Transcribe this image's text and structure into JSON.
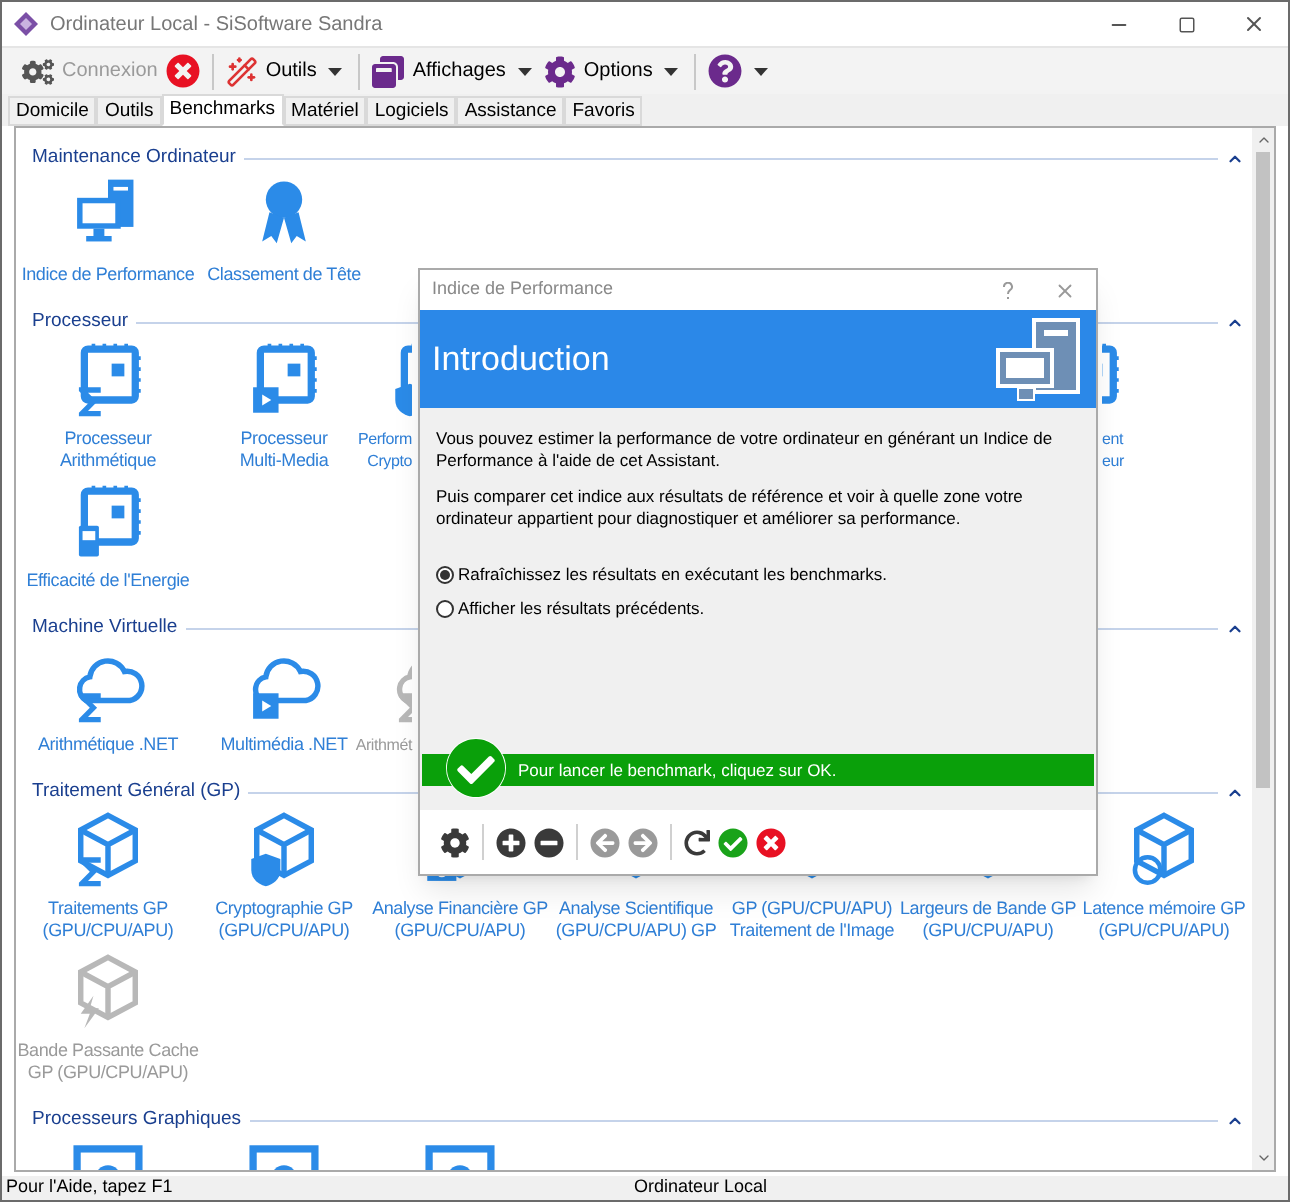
{
  "window": {
    "title": "Ordinateur Local - SiSoftware Sandra"
  },
  "toolbar": [
    {
      "kind": "connect",
      "label": "Connexion",
      "disabled": true
    },
    {
      "kind": "stop"
    },
    {
      "kind": "tools",
      "label": "Outils",
      "dropdown": true
    },
    {
      "kind": "views",
      "label": "Affichages",
      "dropdown": true
    },
    {
      "kind": "options",
      "label": "Options",
      "dropdown": true
    },
    {
      "kind": "help",
      "dropdown": true
    }
  ],
  "tabs": [
    {
      "label": "Domicile",
      "selected": false
    },
    {
      "label": "Outils",
      "selected": false
    },
    {
      "label": "Benchmarks",
      "selected": true
    },
    {
      "label": "Matériel",
      "selected": false
    },
    {
      "label": "Logiciels",
      "selected": false
    },
    {
      "label": "Assistance",
      "selected": false
    },
    {
      "label": "Favoris",
      "selected": false
    }
  ],
  "sections": [
    {
      "title": "Maintenance Ordinateur",
      "expanded": true,
      "items": [
        {
          "label_lines": [
            "Indice de Performance"
          ],
          "disabled": false
        },
        {
          "label_lines": [
            "Classement de Tête"
          ],
          "disabled": false
        }
      ]
    },
    {
      "title": "Processeur",
      "expanded": true,
      "items": [
        {
          "label_lines": [
            "Processeur",
            "Arithmétique"
          ],
          "disabled": false
        },
        {
          "label_lines": [
            "Processeur",
            "Multi-Media"
          ],
          "disabled": false
        },
        {
          "label_lines": [
            "Perform",
            "Crypto"
          ],
          "disabled": false,
          "covered_on_right": true
        },
        {
          "label_lines": [
            "ent",
            "eur"
          ],
          "disabled": false,
          "covered_on_left": true
        },
        {
          "label_lines": [
            "Efficacité de l'Energie"
          ],
          "disabled": false
        }
      ]
    },
    {
      "title": "Machine Virtuelle",
      "expanded": true,
      "items": [
        {
          "label_lines": [
            "Arithmétique .NET"
          ],
          "disabled": false
        },
        {
          "label_lines": [
            "Multimédia .NET"
          ],
          "disabled": false
        },
        {
          "label_lines": [
            "Arithmét"
          ],
          "disabled": true,
          "covered_on_right": true
        }
      ]
    },
    {
      "title": "Traitement Général (GP)",
      "expanded": true,
      "items": [
        {
          "label_lines": [
            "Traitements GP",
            "(GPU/CPU/APU)"
          ],
          "disabled": false
        },
        {
          "label_lines": [
            "Cryptographie GP",
            "(GPU/CPU/APU)"
          ],
          "disabled": false
        },
        {
          "label_lines": [
            "Analyse Financière GP",
            "(GPU/CPU/APU)"
          ],
          "disabled": false
        },
        {
          "label_lines": [
            "Analyse Scientifique",
            "(GPU/CPU/APU) GP"
          ],
          "disabled": false
        },
        {
          "label_lines": [
            "GP (GPU/CPU/APU)",
            "Traitement de l'Image"
          ],
          "disabled": false
        },
        {
          "label_lines": [
            "Largeurs de Bande GP",
            "(GPU/CPU/APU)"
          ],
          "disabled": false
        },
        {
          "label_lines": [
            "Latence mémoire GP",
            "(GPU/CPU/APU)"
          ],
          "disabled": false
        },
        {
          "label_lines": [
            "Bande Passante Cache",
            "GP (GPU/CPU/APU)"
          ],
          "disabled": true
        }
      ]
    },
    {
      "title": "Processeurs Graphiques",
      "expanded": true,
      "items": [
        {
          "disabled": false
        },
        {
          "disabled": false
        },
        {
          "disabled": false
        }
      ]
    }
  ],
  "dialog": {
    "title": "Indice de Performance",
    "heading": "Introduction",
    "paragraphs": [
      "Vous pouvez estimer la performance de votre ordinateur en générant un Indice de Performance à l'aide de cet Assistant.",
      "Puis comparer cet indice aux résultats de référence et voir à quelle zone votre ordinateur appartient pour diagnostiquer et améliorer sa performance."
    ],
    "options": [
      {
        "label": "Rafraîchissez les résultats en exécutant les benchmarks.",
        "selected": true
      },
      {
        "label": "Afficher les résultats précédents.",
        "selected": false
      }
    ],
    "status": "Pour lancer le benchmark, cliquez sur OK.",
    "tools": [
      {
        "kind": "settings",
        "disabled": false
      },
      {
        "kind": "add",
        "disabled": false
      },
      {
        "kind": "remove",
        "disabled": false
      },
      {
        "kind": "back",
        "disabled": true
      },
      {
        "kind": "forward",
        "disabled": true
      },
      {
        "kind": "refresh",
        "disabled": false
      },
      {
        "kind": "ok",
        "disabled": false
      },
      {
        "kind": "cancel",
        "disabled": false
      }
    ]
  },
  "status_bar": {
    "hint": "Pour l'Aide, tapez F1",
    "center": "Ordinateur Local"
  }
}
